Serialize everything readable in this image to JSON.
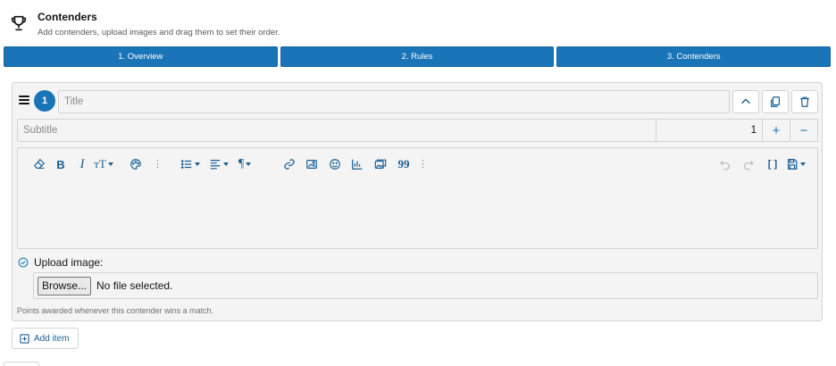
{
  "header": {
    "icon": "trophy-icon",
    "title": "Contenders",
    "subtitle": "Add contenders, upload images and drag them to set their order."
  },
  "steps": [
    {
      "label": "1. Overview"
    },
    {
      "label": "2. Rules"
    },
    {
      "label": "3. Contenders"
    }
  ],
  "colors": {
    "accent": "#1a75b8",
    "border": "#d3d3d3",
    "panel": "#f4f4f4"
  },
  "contender": {
    "number": "1",
    "title_placeholder": "Title",
    "subtitle_placeholder": "Subtitle",
    "points_value": "1",
    "plus_label": "+",
    "minus_label": "−",
    "upload_label": "Upload image:",
    "browse_label": "Browse...",
    "file_status": "No file selected.",
    "points_hint": "Points awarded whenever this contender wins a match."
  },
  "toolbar": {
    "icons": [
      "eraser-icon",
      "bold-icon",
      "italic-icon",
      "text-size-icon",
      "palette-icon",
      "more-icon",
      "list-icon",
      "align-icon",
      "paragraph-icon",
      "link-icon",
      "image-icon",
      "emoji-icon",
      "chart-icon",
      "gallery-icon",
      "quote-icon",
      "more-icon",
      "undo-icon",
      "redo-icon",
      "fullscreen-icon",
      "save-icon"
    ],
    "bold": "B",
    "italic": "I",
    "text_size": "тT",
    "paragraph": "¶",
    "quote": "99",
    "more": "⋮",
    "fullscreen": "[ ]"
  },
  "footer": {
    "add_item_label": "Add item"
  }
}
